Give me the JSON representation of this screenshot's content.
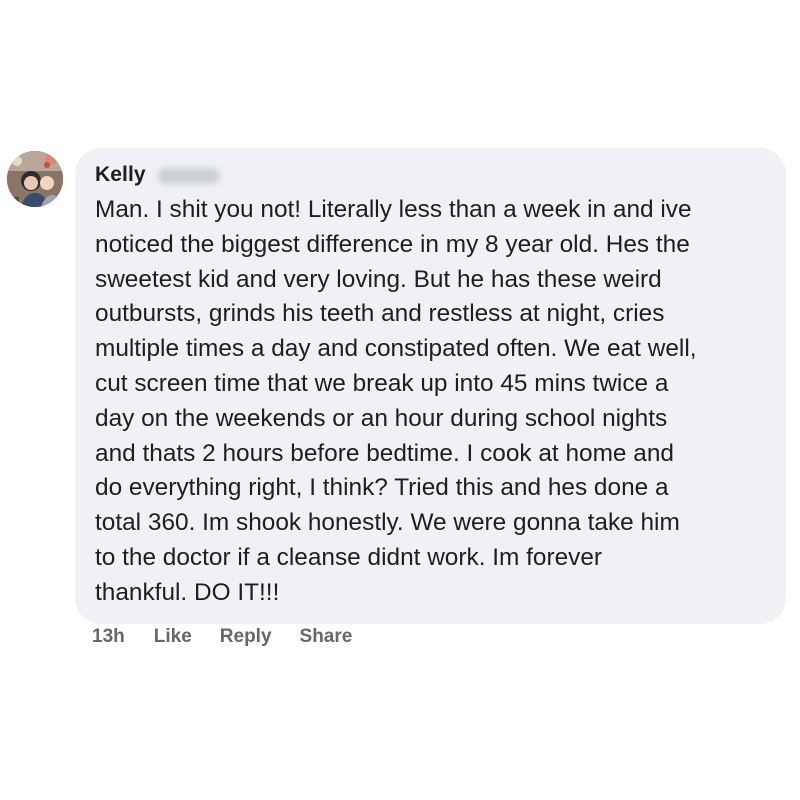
{
  "comment": {
    "author": "Kelly",
    "text": "Man. I shit you not! Literally less than a week in and ive\nnoticed the biggest difference in my 8 year old. Hes the\nsweetest kid and very loving. But he has these weird\noutbursts, grinds his teeth and restless at night, cries\nmultiple times a day and constipated often. We eat well,\ncut screen time that we break up into 45 mins twice a\nday on the weekends or an hour during school nights\nand thats 2 hours before bedtime. I cook at home and\ndo everything right, I think? Tried this and hes done a\ntotal 360. Im shook honestly. We were gonna take him\nto the doctor if a cleanse didnt work. Im forever\nthankful. DO IT!!!",
    "timestamp": "13h",
    "actions": {
      "like": "Like",
      "reply": "Reply",
      "share": "Share"
    }
  },
  "colors": {
    "bubble_background": "#eff1f5",
    "text": "#1c1e21",
    "secondary_text": "#65676b"
  }
}
